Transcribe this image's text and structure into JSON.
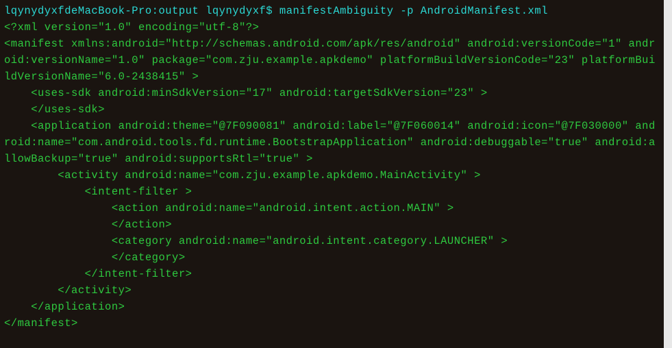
{
  "prompt": {
    "host": "lqynydyxfdeMacBook-Pro",
    "path": "output",
    "user": "lqynydyxf",
    "command": "manifestAmbiguity -p AndroidManifest.xml"
  },
  "output": {
    "l1": "<?xml version=\"1.0\" encoding=\"utf-8\"?>",
    "l2": "<manifest xmlns:android=\"http://schemas.android.com/apk/res/android\" android:versionCode=\"1\" android:versionName=\"1.0\" package=\"com.zju.example.apkdemo\" platformBuildVersionCode=\"23\" platformBuildVersionName=\"6.0-2438415\" >",
    "l3": "    <uses-sdk android:minSdkVersion=\"17\" android:targetSdkVersion=\"23\" >",
    "l4": "    </uses-sdk>",
    "l5": "    <application android:theme=\"@7F090081\" android:label=\"@7F060014\" android:icon=\"@7F030000\" android:name=\"com.android.tools.fd.runtime.BootstrapApplication\" android:debuggable=\"true\" android:allowBackup=\"true\" android:supportsRtl=\"true\" >",
    "l6": "        <activity android:name=\"com.zju.example.apkdemo.MainActivity\" >",
    "l7": "            <intent-filter >",
    "l8": "                <action android:name=\"android.intent.action.MAIN\" >",
    "l9": "                </action>",
    "l10": "                <category android:name=\"android.intent.category.LAUNCHER\" >",
    "l11": "                </category>",
    "l12": "            </intent-filter>",
    "l13": "        </activity>",
    "l14": "    </application>",
    "l15": "</manifest>"
  }
}
